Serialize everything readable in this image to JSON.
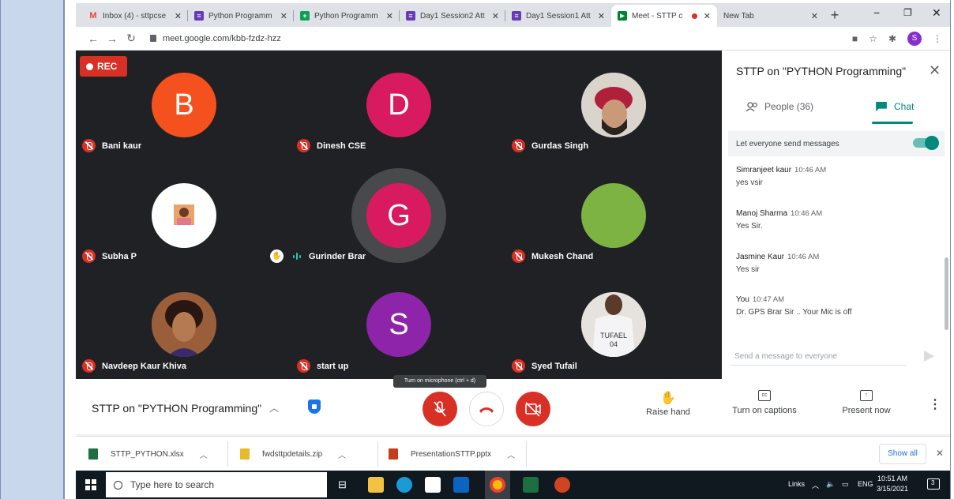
{
  "browser": {
    "tabs": [
      {
        "label": "Inbox (4) - sttpcse",
        "icon": "gmail-icon",
        "color": "#ea4335",
        "glyph": "M"
      },
      {
        "label": "Python Programm",
        "icon": "forms-icon",
        "color": "#673ab7",
        "glyph": "≡"
      },
      {
        "label": "Python Programm",
        "icon": "sheets-icon",
        "color": "#0f9d58",
        "glyph": "+"
      },
      {
        "label": "Day1 Session2 Att",
        "icon": "forms-icon",
        "color": "#673ab7",
        "glyph": "≡"
      },
      {
        "label": "Day1 Session1 Att",
        "icon": "forms-icon",
        "color": "#673ab7",
        "glyph": "≡"
      },
      {
        "label": "Meet - STTP c",
        "icon": "meet-icon",
        "color": "#00832d",
        "glyph": "▶"
      },
      {
        "label": "New Tab",
        "icon": "",
        "color": "",
        "glyph": ""
      }
    ],
    "url": "meet.google.com/kbb-fzdz-hzz",
    "profile_initial": "S"
  },
  "meet": {
    "rec_label": "REC",
    "participants": [
      {
        "name": "Bani kaur",
        "initial": "B",
        "color": "#f4511e",
        "type": "letter"
      },
      {
        "name": "Dinesh CSE",
        "initial": "D",
        "color": "#d81b60",
        "type": "letter"
      },
      {
        "name": "Gurdas Singh",
        "initial": "",
        "color": "#d7d0c6",
        "type": "photo"
      },
      {
        "name": "Subha P",
        "initial": "",
        "color": "#ffffff",
        "type": "photo"
      },
      {
        "name": "Gurinder Brar",
        "initial": "G",
        "color": "#d81b60",
        "type": "letter"
      },
      {
        "name": "Mukesh Chand",
        "initial": "",
        "color": "#7cb342",
        "type": "plain"
      },
      {
        "name": "Navdeep Kaur Khiva",
        "initial": "",
        "color": "#a0603a",
        "type": "photo"
      },
      {
        "name": "start up",
        "initial": "S",
        "color": "#8e24aa",
        "type": "letter"
      },
      {
        "name": "Syed Tufail",
        "initial": "",
        "color": "#e8e6e2",
        "type": "photo"
      }
    ],
    "tufail_caption": "TUFAEL\n04"
  },
  "panel": {
    "title": "STTP on \"PYTHON Programming\"",
    "people_tab": "People (36)",
    "chat_tab": "Chat",
    "let_everyone": "Let everyone send messages",
    "messages": [
      {
        "sender": "Simranjeet kaur",
        "time": "10:46 AM",
        "text": "yes vsir"
      },
      {
        "sender": "Manoj Sharma",
        "time": "10:46 AM",
        "text": "Yes Sir."
      },
      {
        "sender": "Jasmine Kaur",
        "time": "10:46 AM",
        "text": "Yes sir"
      },
      {
        "sender": "You",
        "time": "10:47 AM",
        "text": "Dr. GPS Brar Sir .. Your  Mic is off"
      }
    ],
    "compose_placeholder": "Send a message to everyone"
  },
  "bottombar": {
    "meeting_title": "STTP on \"PYTHON Programming\"",
    "tooltip": "Turn on microphone (ctrl + d)",
    "raise_hand": "Raise hand",
    "captions": "Turn on captions",
    "present": "Present now"
  },
  "downloads": [
    {
      "name": "STTP_PYTHON.xlsx",
      "color": "#1d6f42"
    },
    {
      "name": "fwdsttpdetails.zip",
      "color": "#e8b92a"
    },
    {
      "name": "PresentationSTTP.pptx",
      "color": "#c43e1c"
    }
  ],
  "downloads_show_all": "Show all",
  "taskbar": {
    "search_placeholder": "Type here to search",
    "tray_links": "Links",
    "tray_lang": "ENG",
    "time": "10:51 AM",
    "date": "3/15/2021",
    "notif_count": "3"
  }
}
